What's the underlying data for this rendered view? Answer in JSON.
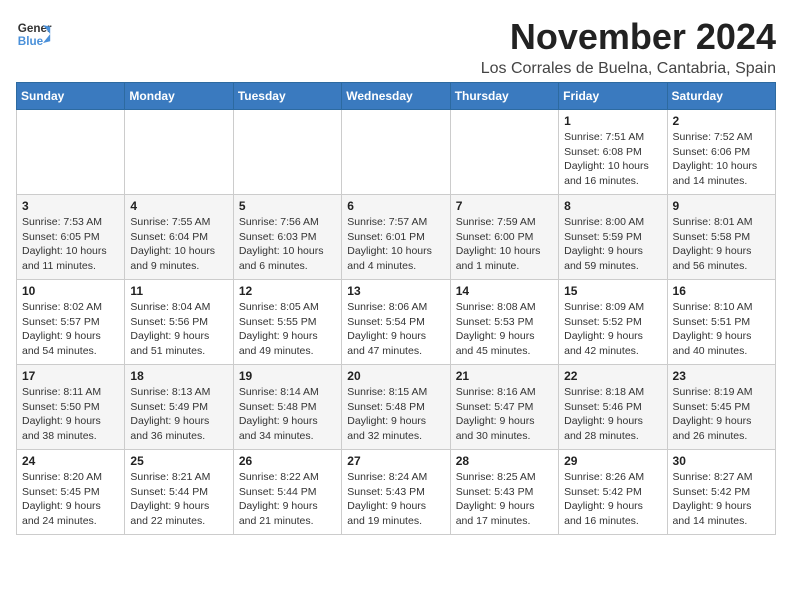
{
  "logo": {
    "line1": "General",
    "line2": "Blue"
  },
  "title": "November 2024",
  "location": "Los Corrales de Buelna, Cantabria, Spain",
  "headers": [
    "Sunday",
    "Monday",
    "Tuesday",
    "Wednesday",
    "Thursday",
    "Friday",
    "Saturday"
  ],
  "weeks": [
    [
      {
        "day": "",
        "info": ""
      },
      {
        "day": "",
        "info": ""
      },
      {
        "day": "",
        "info": ""
      },
      {
        "day": "",
        "info": ""
      },
      {
        "day": "",
        "info": ""
      },
      {
        "day": "1",
        "info": "Sunrise: 7:51 AM\nSunset: 6:08 PM\nDaylight: 10 hours and 16 minutes."
      },
      {
        "day": "2",
        "info": "Sunrise: 7:52 AM\nSunset: 6:06 PM\nDaylight: 10 hours and 14 minutes."
      }
    ],
    [
      {
        "day": "3",
        "info": "Sunrise: 7:53 AM\nSunset: 6:05 PM\nDaylight: 10 hours and 11 minutes."
      },
      {
        "day": "4",
        "info": "Sunrise: 7:55 AM\nSunset: 6:04 PM\nDaylight: 10 hours and 9 minutes."
      },
      {
        "day": "5",
        "info": "Sunrise: 7:56 AM\nSunset: 6:03 PM\nDaylight: 10 hours and 6 minutes."
      },
      {
        "day": "6",
        "info": "Sunrise: 7:57 AM\nSunset: 6:01 PM\nDaylight: 10 hours and 4 minutes."
      },
      {
        "day": "7",
        "info": "Sunrise: 7:59 AM\nSunset: 6:00 PM\nDaylight: 10 hours and 1 minute."
      },
      {
        "day": "8",
        "info": "Sunrise: 8:00 AM\nSunset: 5:59 PM\nDaylight: 9 hours and 59 minutes."
      },
      {
        "day": "9",
        "info": "Sunrise: 8:01 AM\nSunset: 5:58 PM\nDaylight: 9 hours and 56 minutes."
      }
    ],
    [
      {
        "day": "10",
        "info": "Sunrise: 8:02 AM\nSunset: 5:57 PM\nDaylight: 9 hours and 54 minutes."
      },
      {
        "day": "11",
        "info": "Sunrise: 8:04 AM\nSunset: 5:56 PM\nDaylight: 9 hours and 51 minutes."
      },
      {
        "day": "12",
        "info": "Sunrise: 8:05 AM\nSunset: 5:55 PM\nDaylight: 9 hours and 49 minutes."
      },
      {
        "day": "13",
        "info": "Sunrise: 8:06 AM\nSunset: 5:54 PM\nDaylight: 9 hours and 47 minutes."
      },
      {
        "day": "14",
        "info": "Sunrise: 8:08 AM\nSunset: 5:53 PM\nDaylight: 9 hours and 45 minutes."
      },
      {
        "day": "15",
        "info": "Sunrise: 8:09 AM\nSunset: 5:52 PM\nDaylight: 9 hours and 42 minutes."
      },
      {
        "day": "16",
        "info": "Sunrise: 8:10 AM\nSunset: 5:51 PM\nDaylight: 9 hours and 40 minutes."
      }
    ],
    [
      {
        "day": "17",
        "info": "Sunrise: 8:11 AM\nSunset: 5:50 PM\nDaylight: 9 hours and 38 minutes."
      },
      {
        "day": "18",
        "info": "Sunrise: 8:13 AM\nSunset: 5:49 PM\nDaylight: 9 hours and 36 minutes."
      },
      {
        "day": "19",
        "info": "Sunrise: 8:14 AM\nSunset: 5:48 PM\nDaylight: 9 hours and 34 minutes."
      },
      {
        "day": "20",
        "info": "Sunrise: 8:15 AM\nSunset: 5:48 PM\nDaylight: 9 hours and 32 minutes."
      },
      {
        "day": "21",
        "info": "Sunrise: 8:16 AM\nSunset: 5:47 PM\nDaylight: 9 hours and 30 minutes."
      },
      {
        "day": "22",
        "info": "Sunrise: 8:18 AM\nSunset: 5:46 PM\nDaylight: 9 hours and 28 minutes."
      },
      {
        "day": "23",
        "info": "Sunrise: 8:19 AM\nSunset: 5:45 PM\nDaylight: 9 hours and 26 minutes."
      }
    ],
    [
      {
        "day": "24",
        "info": "Sunrise: 8:20 AM\nSunset: 5:45 PM\nDaylight: 9 hours and 24 minutes."
      },
      {
        "day": "25",
        "info": "Sunrise: 8:21 AM\nSunset: 5:44 PM\nDaylight: 9 hours and 22 minutes."
      },
      {
        "day": "26",
        "info": "Sunrise: 8:22 AM\nSunset: 5:44 PM\nDaylight: 9 hours and 21 minutes."
      },
      {
        "day": "27",
        "info": "Sunrise: 8:24 AM\nSunset: 5:43 PM\nDaylight: 9 hours and 19 minutes."
      },
      {
        "day": "28",
        "info": "Sunrise: 8:25 AM\nSunset: 5:43 PM\nDaylight: 9 hours and 17 minutes."
      },
      {
        "day": "29",
        "info": "Sunrise: 8:26 AM\nSunset: 5:42 PM\nDaylight: 9 hours and 16 minutes."
      },
      {
        "day": "30",
        "info": "Sunrise: 8:27 AM\nSunset: 5:42 PM\nDaylight: 9 hours and 14 minutes."
      }
    ]
  ]
}
